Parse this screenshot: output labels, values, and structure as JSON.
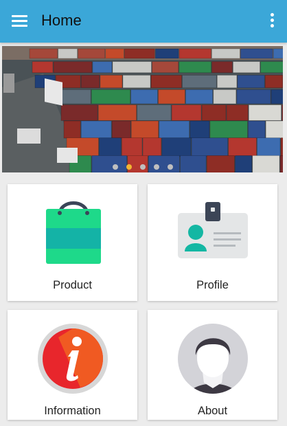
{
  "appbar": {
    "title": "Home",
    "menu_icon": "hamburger-menu-icon",
    "overflow_icon": "more-vert-icon",
    "color": "#3ba7d8"
  },
  "banner": {
    "image": "shipping-containers-photo",
    "pages": 5,
    "active_page": 2,
    "active_dot_color": "#f2b632"
  },
  "grid": {
    "items": [
      {
        "label": "Product",
        "icon": "shopping-bag-icon"
      },
      {
        "label": "Profile",
        "icon": "id-card-icon"
      },
      {
        "label": "Information",
        "icon": "info-icon"
      },
      {
        "label": "About",
        "icon": "user-avatar-icon"
      }
    ]
  }
}
